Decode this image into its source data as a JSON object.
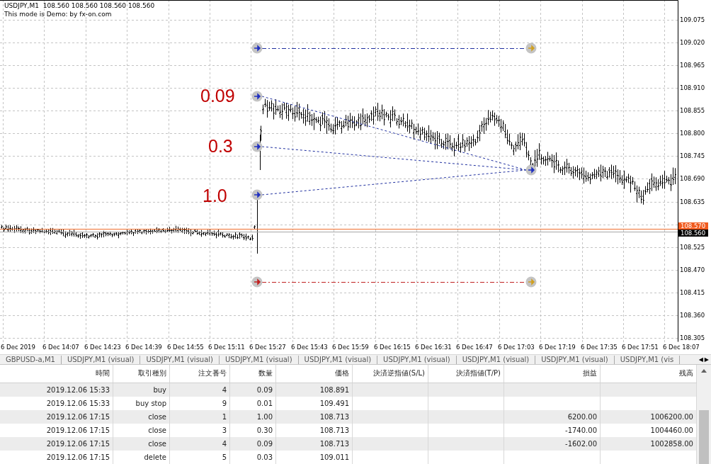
{
  "chart": {
    "header": [
      "USDJPY,M1  108.560 108.560 108.560 108.560",
      "This mode is Demo: by fx-on.com"
    ],
    "lot_labels": [
      "0.09",
      "0.3",
      "1.0"
    ],
    "price_axis": {
      "labels": [
        "109.075",
        "109.020",
        "108.965",
        "108.910",
        "108.855",
        "108.800",
        "108.745",
        "108.690",
        "108.635",
        "108.525",
        "108.470",
        "108.415",
        "108.360",
        "108.305"
      ],
      "markers": [
        {
          "label": "108.570",
          "color": "#f05a1e"
        },
        {
          "label": "108.560",
          "color": "#000000"
        }
      ]
    },
    "time_axis": {
      "labels": [
        "6 Dec 2019",
        "6 Dec 14:07",
        "6 Dec 14:23",
        "6 Dec 14:39",
        "6 Dec 14:55",
        "6 Dec 15:11",
        "6 Dec 15:27",
        "6 Dec 15:43",
        "6 Dec 15:59",
        "6 Dec 16:15",
        "6 Dec 16:31",
        "6 Dec 16:47",
        "6 Dec 17:03",
        "6 Dec 17:19",
        "6 Dec 17:35",
        "6 Dec 17:51",
        "6 Dec 18:07"
      ]
    }
  },
  "chart_tabs": {
    "tabs": [
      {
        "label": "GBPUSD-a,M1"
      },
      {
        "label": "USDJPY,M1 (visual)"
      },
      {
        "label": "USDJPY,M1 (visual)"
      },
      {
        "label": "USDJPY,M1 (visual)"
      },
      {
        "label": "USDJPY,M1 (visual)"
      },
      {
        "label": "USDJPY,M1 (visual)"
      },
      {
        "label": "USDJPY,M1 (visual)"
      },
      {
        "label": "USDJPY,M1 (visual)"
      },
      {
        "label": "USDJPY,M1 (vis"
      }
    ],
    "scroll_left": "◀",
    "scroll_right": "▶"
  },
  "table": {
    "columns": [
      "時間",
      "取引種別",
      "注文番号",
      "数量",
      "価格",
      "決済逆指値(S/L)",
      "決済指値(T/P)",
      "損益",
      "残高"
    ],
    "rows": [
      [
        "2019.12.06 15:33",
        "buy",
        "4",
        "0.09",
        "108.891",
        "",
        "",
        "",
        ""
      ],
      [
        "2019.12.06 15:33",
        "buy stop",
        "9",
        "0.01",
        "109.491",
        "",
        "",
        "",
        ""
      ],
      [
        "2019.12.06 17:15",
        "close",
        "1",
        "1.00",
        "108.713",
        "",
        "",
        "6200.00",
        "1006200.00"
      ],
      [
        "2019.12.06 17:15",
        "close",
        "3",
        "0.30",
        "108.713",
        "",
        "",
        "-1740.00",
        "1004460.00"
      ],
      [
        "2019.12.06 17:15",
        "close",
        "4",
        "0.09",
        "108.713",
        "",
        "",
        "-1602.00",
        "1002858.00"
      ],
      [
        "2019.12.06 17:15",
        "delete",
        "5",
        "0.03",
        "109.011",
        "",
        "",
        "",
        ""
      ]
    ]
  }
}
